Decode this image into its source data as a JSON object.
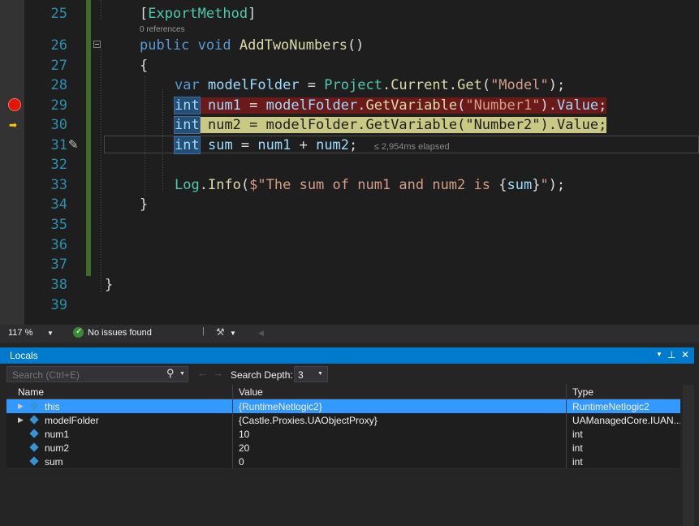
{
  "editor": {
    "lines": [
      {
        "n": "25"
      },
      {
        "n": "26"
      },
      {
        "n": "27"
      },
      {
        "n": "28"
      },
      {
        "n": "29"
      },
      {
        "n": "30"
      },
      {
        "n": "31"
      },
      {
        "n": "32"
      },
      {
        "n": "33"
      },
      {
        "n": "34"
      },
      {
        "n": "35"
      },
      {
        "n": "36"
      },
      {
        "n": "37"
      },
      {
        "n": "38"
      },
      {
        "n": "39"
      }
    ],
    "codelens": "0 references",
    "elapsed": "≤ 2,954ms elapsed",
    "tokens": {
      "attr": "ExportMethod",
      "public": "public",
      "void": "void",
      "method": "AddTwoNumbers",
      "var": "var",
      "modelFolder": "modelFolder",
      "project": "Project",
      "current": "Current",
      "get": "Get",
      "model_str": "\"Model\"",
      "int": "int",
      "num1": "num1",
      "num2": "num2",
      "sum": "sum",
      "getvar": "GetVariable",
      "number1_str": "\"Number1\"",
      "number2_str": "\"Number2\"",
      "value": "Value",
      "log": "Log",
      "info": "Info",
      "interp_start": "$\"The sum of num1 and num2 is ",
      "interp_end": "\""
    },
    "colors": {
      "breakpoint": "#e51400",
      "current_arrow": "#ffcc00"
    }
  },
  "status": {
    "zoom": "117 %",
    "issues": "No issues found"
  },
  "locals": {
    "title": "Locals",
    "search_placeholder": "Search (Ctrl+E)",
    "search_depth_label": "Search Depth:",
    "search_depth_value": "3",
    "columns": [
      "Name",
      "Value",
      "Type"
    ],
    "rows": [
      {
        "name": "this",
        "value": "{RuntimeNetlogic2}",
        "type": "RuntimeNetlogic2",
        "expandable": true,
        "selected": true
      },
      {
        "name": "modelFolder",
        "value": "{Castle.Proxies.UAObjectProxy}",
        "type": "UAManagedCore.IUAN...",
        "expandable": true,
        "selected": false
      },
      {
        "name": "num1",
        "value": "10",
        "type": "int",
        "expandable": false,
        "selected": false
      },
      {
        "name": "num2",
        "value": "20",
        "type": "int",
        "expandable": false,
        "selected": false
      },
      {
        "name": "sum",
        "value": "0",
        "type": "int",
        "expandable": false,
        "selected": false
      }
    ]
  }
}
